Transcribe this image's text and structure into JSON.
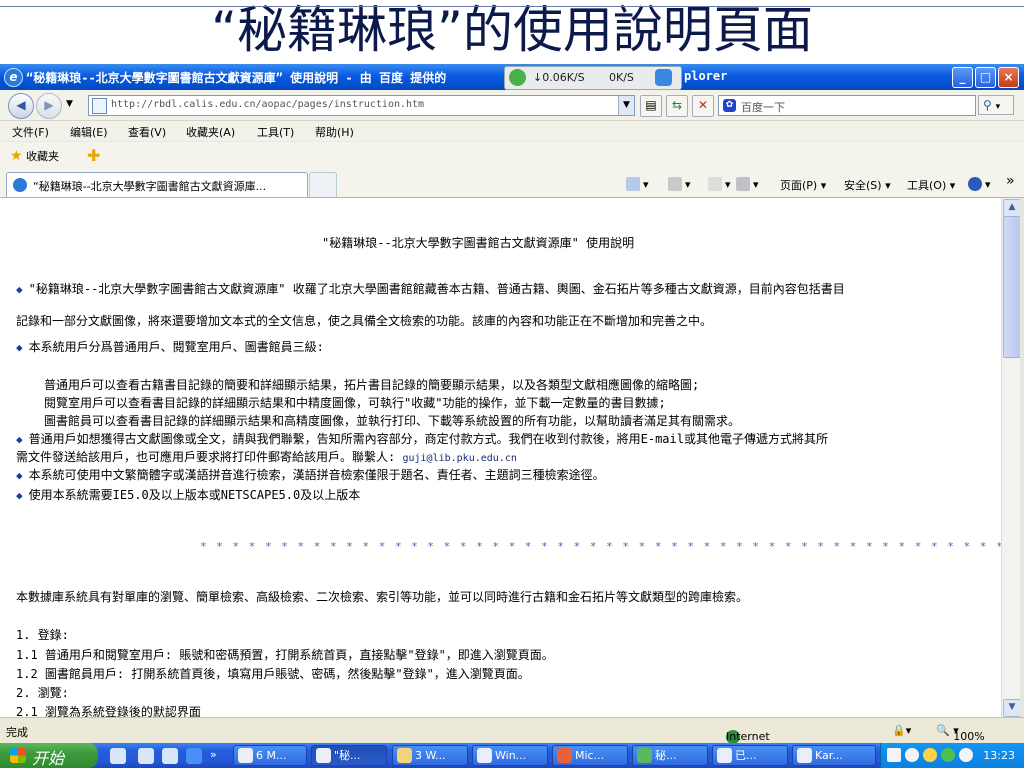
{
  "slide": {
    "title": "“秘籍琳琅”的使用說明頁面"
  },
  "window": {
    "title": "“秘籍琳琅--北京大學數字圖書館古文獻資源庫” 使用說明 - 由 百度 提供的",
    "title_suffix": "plorer",
    "net_widget": {
      "down": "↓0.06K/S",
      "up": "0K/S"
    },
    "controls": {
      "minimize": "_",
      "maximize": "□",
      "close": "×"
    }
  },
  "address_bar": {
    "url": "http://rbdl.calis.edu.cn/aopac/pages/instruction.htm",
    "search_placeholder": "百度一下"
  },
  "menu": [
    "文件(F)",
    "编辑(E)",
    "查看(V)",
    "收藏夹(A)",
    "工具(T)",
    "帮助(H)"
  ],
  "favorites": {
    "label": "收藏夹"
  },
  "tab": {
    "title": "“秘籍琳琅--北京大學數字圖書館古文獻資源庫..."
  },
  "command_bar": {
    "page": "页面(P)",
    "safety": "安全(S)",
    "tools": "工具(O)"
  },
  "content": {
    "heading": "\"秘籍琳琅--北京大學數字圖書館古文獻資源庫\" 使用說明",
    "p1a": "\"秘籍琳琅--北京大學數字圖書館古文獻資源庫\" 收羅了北京大學圖書館館藏善本古籍、普通古籍、輿圖、金石拓片等多種古文獻資源，目前內容包括書目",
    "p1b": "記錄和一部分文獻圖像，將來還要增加文本式的全文信息，使之具備全文檢索的功能。該庫的內容和功能正在不斷增加和完善之中。",
    "p2": "本系統用戶分爲普通用戶、閱覽室用戶、圖書館員三級:",
    "p2a": "普通用戶可以查看古籍書目記錄的簡要和詳細顯示結果，拓片書目記錄的簡要顯示結果，以及各類型文獻相應圖像的縮略圖;",
    "p2b": "閱覽室用戶可以查看書目記錄的詳細顯示結果和中精度圖像，可執行\"收藏\"功能的操作，並下載一定數量的書目數據;",
    "p2c": "圖書館員可以查看書目記錄的詳細顯示結果和高精度圖像，並執行打印、下載等系統設置的所有功能，以幫助讀者滿足其有關需求。",
    "p3a": "普通用戶如想獲得古文獻圖像或全文，請與我們聯繫，告知所需內容部分，商定付款方式。我們在收到付款後，將用E-mail或其他電子傳遞方式將其所",
    "p3b": "需文件發送給該用戶，也可應用戶要求將打印件郵寄給該用戶。聯繫人:",
    "p3_email": "guji@lib.pku.edu.cn",
    "p4": "本系統可使用中文繁簡體字或漢語拼音進行檢索，漢語拼音檢索僅限于題名、責任者、主題詞三種檢索途徑。",
    "p5": "使用本系統需要IE5.0及以上版本或NETSCAPE5.0及以上版本",
    "stars": "* * * * * * * * * * * * * * * * * * * * * * * * * * * * * * * * * * * * * * * * * * * * * * * * * * * * * * * * * * * * * * * * * * *",
    "p6": "本數據庫系統具有對單庫的瀏覽、簡單檢索、高級檢索、二次檢索、索引等功能，並可以同時進行古籍和金石拓片等文獻類型的跨庫檢索。",
    "s1": "1. 登錄:",
    "s11": "1.1 普通用戶和閱覽室用戶: 賬號和密碼預置，打開系統首頁，直接點擊\"登錄\"，即進入瀏覽頁面。",
    "s12": "1.2 圖書館員用戶: 打開系統首頁後，填寫用戶賬號、密碼，然後點擊\"登錄\"，進入瀏覽頁面。",
    "s2": "2. 瀏覽:",
    "s21": "2.1 瀏覽為系統登錄後的默認界面"
  },
  "status": {
    "text": "完成",
    "zone": "Internet",
    "zoom": "100%"
  },
  "taskbar": {
    "start": "开始",
    "tasks": [
      "6 M...",
      "\"秘...",
      "3 W...",
      "Win...",
      "Mic...",
      "秘...",
      "已...",
      "Kar..."
    ],
    "clock": "13:23"
  }
}
